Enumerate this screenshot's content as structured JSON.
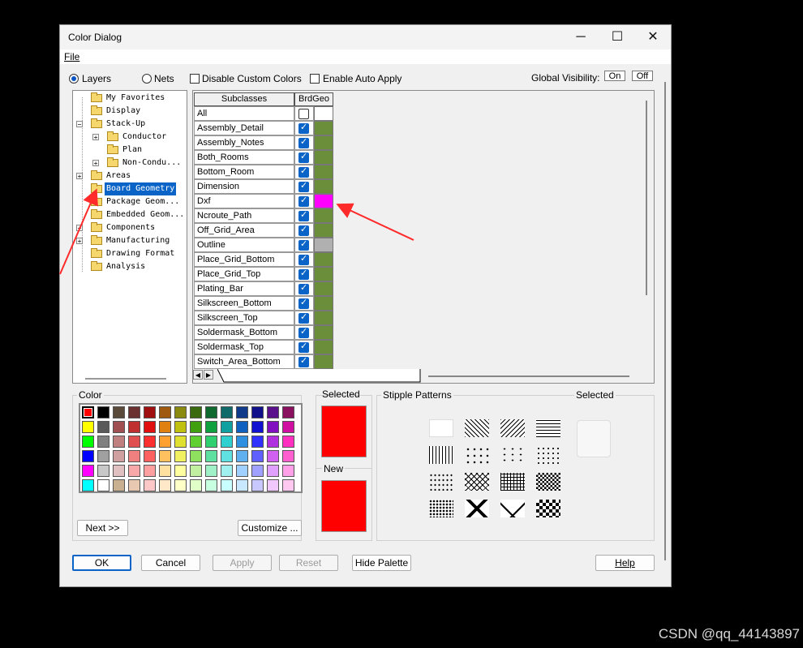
{
  "window": {
    "title": "Color Dialog",
    "minimize": "─",
    "maximize": "☐",
    "close": "✕"
  },
  "menu": {
    "file": "File"
  },
  "top": {
    "layers": "Layers",
    "nets": "Nets",
    "disable_custom": "Disable Custom Colors",
    "enable_auto": "Enable Auto Apply",
    "global_visibility": "Global Visibility:",
    "on": "On",
    "off": "Off"
  },
  "tree": [
    {
      "label": "My Favorites"
    },
    {
      "label": "Display"
    },
    {
      "label": "Stack-Up"
    },
    {
      "label": "Conductor"
    },
    {
      "label": "Plan"
    },
    {
      "label": "Non-Condu..."
    },
    {
      "label": "Areas"
    },
    {
      "label": "Board Geometry",
      "selected": true
    },
    {
      "label": "Package Geom..."
    },
    {
      "label": "Embedded Geom..."
    },
    {
      "label": "Components"
    },
    {
      "label": "Manufacturing"
    },
    {
      "label": "Drawing Format"
    },
    {
      "label": "Analysis"
    }
  ],
  "grid": {
    "col_subclasses": "Subclasses",
    "col_brdgeo": "BrdGeo",
    "all_label": "All",
    "rows": [
      {
        "name": "Assembly_Detail",
        "color": "#6b8e3a"
      },
      {
        "name": "Assembly_Notes",
        "color": "#6b8e3a"
      },
      {
        "name": "Both_Rooms",
        "color": "#6b8e3a"
      },
      {
        "name": "Bottom_Room",
        "color": "#6b8e3a"
      },
      {
        "name": "Dimension",
        "color": "#6b8e3a"
      },
      {
        "name": "Dxf",
        "color": "#ff00ff"
      },
      {
        "name": "Ncroute_Path",
        "color": "#6b8e3a"
      },
      {
        "name": "Off_Grid_Area",
        "color": "#6b8e3a"
      },
      {
        "name": "Outline",
        "color": "#b0b0b0"
      },
      {
        "name": "Place_Grid_Bottom",
        "color": "#6b8e3a"
      },
      {
        "name": "Place_Grid_Top",
        "color": "#6b8e3a"
      },
      {
        "name": "Plating_Bar",
        "color": "#6b8e3a"
      },
      {
        "name": "Silkscreen_Bottom",
        "color": "#6b8e3a"
      },
      {
        "name": "Silkscreen_Top",
        "color": "#6b8e3a"
      },
      {
        "name": "Soldermask_Bottom",
        "color": "#6b8e3a"
      },
      {
        "name": "Soldermask_Top",
        "color": "#6b8e3a"
      },
      {
        "name": "Switch_Area_Bottom",
        "color": "#6b8e3a"
      }
    ]
  },
  "color_section": {
    "title": "Color",
    "next": "Next >>",
    "customize": "Customize ...",
    "selected": "Selected",
    "new": "New",
    "palette": [
      [
        "#ff0000",
        "#000000",
        "#5a4a3a",
        "#6b3030",
        "#a01010",
        "#a05a10",
        "#8a8a10",
        "#3a6a10",
        "#106a30",
        "#106a6a",
        "#103a8a",
        "#10108a",
        "#5a108a",
        "#8a1060"
      ],
      [
        "#ffff00",
        "#5a5a5a",
        "#a05050",
        "#c03030",
        "#e01010",
        "#e08010",
        "#c0c010",
        "#40a010",
        "#10a040",
        "#10a0a0",
        "#1060c0",
        "#1010d0",
        "#8010c0",
        "#d010a0"
      ],
      [
        "#00ff00",
        "#808080",
        "#c08080",
        "#e05050",
        "#ff3030",
        "#ffa030",
        "#e0e030",
        "#60d030",
        "#30d070",
        "#30d0d0",
        "#3090e0",
        "#3030ff",
        "#b030e0",
        "#ff30c0"
      ],
      [
        "#0000ff",
        "#a0a0a0",
        "#d0a0a0",
        "#f08080",
        "#ff6060",
        "#ffc060",
        "#f0f060",
        "#90e060",
        "#60e0a0",
        "#60e0e0",
        "#60b0f0",
        "#6060ff",
        "#d060f0",
        "#ff60d0"
      ],
      [
        "#ff00ff",
        "#c8c8c8",
        "#e0c0c0",
        "#f8a8a8",
        "#ffa0a0",
        "#ffe0a0",
        "#ffffa0",
        "#c0f0a0",
        "#a0f0c8",
        "#a0f0f0",
        "#a0d0ff",
        "#a0a0ff",
        "#e0a0ff",
        "#ffa0e8"
      ],
      [
        "#00ffff",
        "#ffffff",
        "#c8b090",
        "#e8c8b0",
        "#ffc8c8",
        "#ffe8c8",
        "#ffffc8",
        "#e0ffc8",
        "#c8ffe0",
        "#c8ffff",
        "#c8e8ff",
        "#c8c8ff",
        "#f0c8ff",
        "#ffc8f0"
      ]
    ]
  },
  "stipple": {
    "title": "Stipple Patterns",
    "selected": "Selected"
  },
  "buttons": {
    "ok": "OK",
    "cancel": "Cancel",
    "apply": "Apply",
    "reset": "Reset",
    "hide_palette": "Hide Palette",
    "help": "Help"
  },
  "watermark": "CSDN @qq_44143897"
}
